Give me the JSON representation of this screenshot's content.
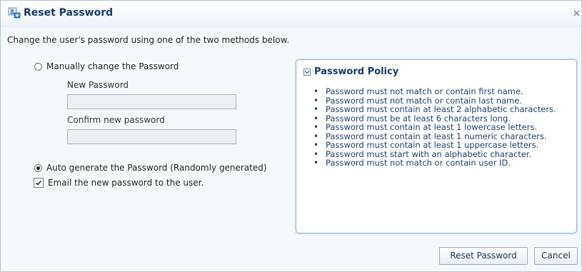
{
  "dialog": {
    "title": "Reset Password",
    "close_icon": "close-icon"
  },
  "intro_text": "Change the user's password using one of the two methods below.",
  "manual_option": {
    "label": "Manually change the Password",
    "selected": false
  },
  "new_password": {
    "label": "New Password",
    "value": ""
  },
  "confirm_password": {
    "label": "Confirm new password",
    "value": ""
  },
  "auto_option": {
    "label": "Auto generate the Password (Randomly generated)",
    "selected": true
  },
  "email_option": {
    "label": "Email the new password to the user.",
    "checked": true
  },
  "policy": {
    "title": "Password Policy",
    "items": [
      "Password must not match or contain first name.",
      "Password must not match or contain last name.",
      "Password must contain at least 2 alphabetic characters.",
      "Password must be at least 6 characters long.",
      "Password must contain at least 1 lowercase letters.",
      "Password must contain at least 1 numeric characters.",
      "Password must contain at least 1 uppercase letters.",
      "Password must start with an alphabetic character.",
      "Password must not match or contain user ID."
    ]
  },
  "buttons": {
    "reset": "Reset Password",
    "cancel": "Cancel"
  },
  "icons": {
    "title_icon": "user-key-icon",
    "radio_icon": "radio-button-icon",
    "checkbox_icon": "checkbox-icon",
    "collapse_icon": "chevron-down-icon"
  },
  "colors": {
    "accent": "#183a66",
    "panel_border": "#9aaec8",
    "background": "#f6f9fc"
  }
}
